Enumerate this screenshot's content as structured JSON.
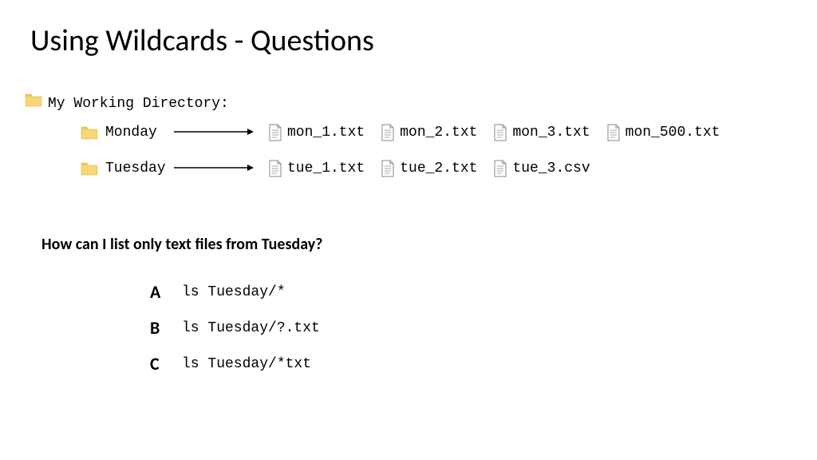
{
  "title": "Using Wildcards - Questions",
  "directory_label": "My Working Directory:",
  "folders": {
    "monday": {
      "name": "Monday",
      "files": [
        "mon_1.txt",
        "mon_2.txt",
        "mon_3.txt",
        "mon_500.txt"
      ]
    },
    "tuesday": {
      "name": "Tuesday",
      "files": [
        "tue_1.txt",
        "tue_2.txt",
        "tue_3.csv"
      ]
    }
  },
  "question": "How can I list only text files from Tuesday?",
  "options": [
    {
      "letter": "A",
      "command": "ls Tuesday/*"
    },
    {
      "letter": "B",
      "command": "ls Tuesday/?.txt"
    },
    {
      "letter": "C",
      "command": "ls Tuesday/*txt"
    }
  ]
}
